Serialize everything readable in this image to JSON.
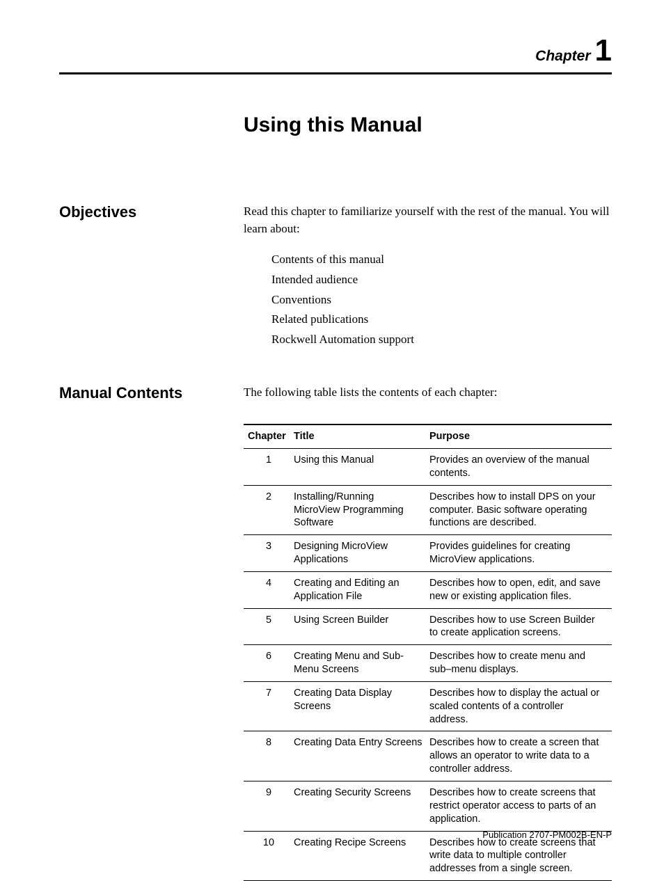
{
  "header": {
    "chapter_label": "Chapter",
    "chapter_number": "1"
  },
  "title": "Using this Manual",
  "sections": {
    "objectives": {
      "label": "Objectives",
      "intro": "Read this chapter to familiarize yourself with the rest of the manual. You will learn about:",
      "bullets": [
        "Contents of this manual",
        "Intended audience",
        "Conventions",
        "Related publications",
        "Rockwell Automation support"
      ]
    },
    "manual_contents": {
      "label": "Manual Contents",
      "intro": "The following table lists the contents of each chapter:",
      "table": {
        "headers": [
          "Chapter",
          "Title",
          "Purpose"
        ],
        "rows": [
          {
            "chapter": "1",
            "title": "Using this Manual",
            "purpose": "Provides an overview of the manual contents."
          },
          {
            "chapter": "2",
            "title": "Installing/Running MicroView Programming Software",
            "purpose": "Describes how to install DPS on your computer.  Basic software operating functions are described."
          },
          {
            "chapter": "3",
            "title": "Designing MicroView Applications",
            "purpose": "Provides guidelines for creating MicroView applications."
          },
          {
            "chapter": "4",
            "title": "Creating and Editing an Application File",
            "purpose": "Describes how to open, edit,  and save new or existing application files."
          },
          {
            "chapter": "5",
            "title": "Using Screen Builder",
            "purpose": "Describes how to use Screen Builder to create application screens."
          },
          {
            "chapter": "6",
            "title": "Creating Menu and Sub-Menu Screens",
            "purpose": "Describes how to create menu and sub–menu displays."
          },
          {
            "chapter": "7",
            "title": "Creating Data Display Screens",
            "purpose": "Describes how to display the actual or scaled contents of a controller address."
          },
          {
            "chapter": "8",
            "title": "Creating Data Entry Screens",
            "purpose": "Describes how to create a screen that allows an operator to write data to a controller address."
          },
          {
            "chapter": "9",
            "title": "Creating Security Screens",
            "purpose": "Describes how to create screens that restrict operator access to parts of an application."
          },
          {
            "chapter": "10",
            "title": "Creating Recipe Screens",
            "purpose": "Describes how to create screens that write data to multiple controller addresses from a single screen."
          }
        ]
      }
    }
  },
  "footer": {
    "publication": "Publication 2707-PM002B-EN-P"
  }
}
